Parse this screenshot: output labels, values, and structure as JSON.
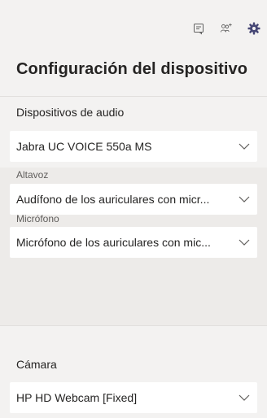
{
  "header": {
    "title": "Configuración del dispositivo",
    "icons": [
      "chat-icon",
      "people-add-icon",
      "gear-icon"
    ],
    "accent_color": "#464775"
  },
  "audio": {
    "section_label": "Dispositivos de audio",
    "device_value": "Jabra UC VOICE 550a MS",
    "speaker_label": "Altavoz",
    "speaker_value": "Audífono de los auriculares con micr...",
    "mic_label": "Micrófono",
    "mic_value": "Micrófono de los auriculares con mic..."
  },
  "camera": {
    "section_label": "Cámara",
    "device_value": "HP HD Webcam [Fixed]"
  }
}
